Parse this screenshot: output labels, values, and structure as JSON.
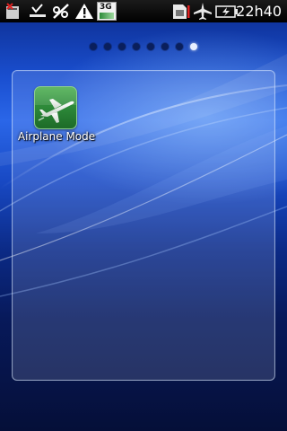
{
  "status_bar": {
    "time": "22h40",
    "network_label": "3G",
    "icons_left": [
      "sd-card-error-icon",
      "download-complete-icon",
      "usb-debug-icon",
      "warning-icon",
      "network-3g-icon"
    ],
    "icons_right": [
      "sim-card-icon",
      "airplane-icon",
      "battery-icon"
    ]
  },
  "home_pager": {
    "page_count": 8,
    "active_page": 8
  },
  "folder": {
    "apps": [
      {
        "label": "Airplane Mode",
        "icon": "airplane-icon"
      }
    ]
  },
  "colors": {
    "status_bar_bg": "#000000",
    "app_icon_green": "#2e8b3a",
    "wallpaper_blue": "#1a4fd0"
  }
}
